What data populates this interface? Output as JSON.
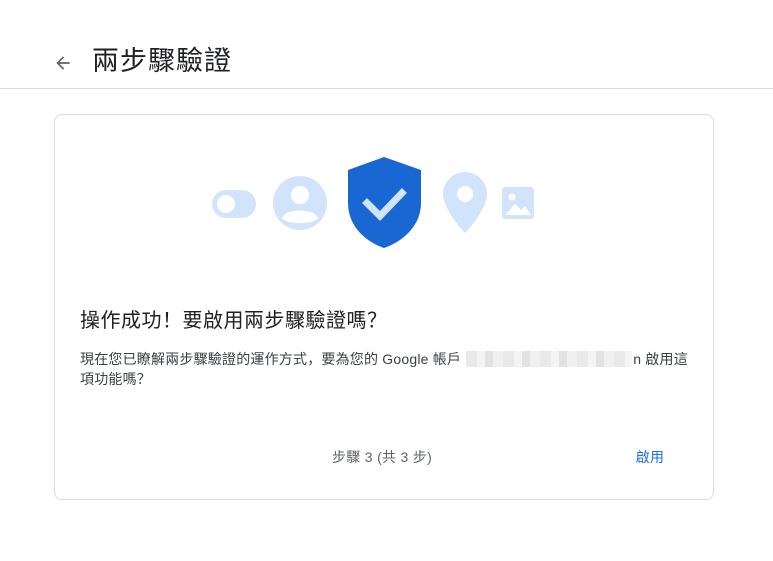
{
  "header": {
    "back_icon": "arrow-back-icon",
    "title": "兩步驟驗證"
  },
  "illustration": {
    "icons": [
      "toggle-icon",
      "account-circle-icon",
      "shield-check-icon",
      "location-pin-icon",
      "image-icon"
    ],
    "colors": {
      "light_blue": "#d2e3fc",
      "shield_blue": "#1967d2"
    }
  },
  "card": {
    "title": "操作成功！要啟用兩步驟驗證嗎？",
    "desc_part1": "現在您已瞭解兩步驟驗證的運作方式，要為您的 Google 帳戶 ",
    "desc_part2": "n 啟用這項功能嗎？",
    "step_text": "步驟 3 (共 3 步)",
    "enable_label": "啟用"
  },
  "colors": {
    "accent": "#1a73e8",
    "border": "#dadce0"
  }
}
